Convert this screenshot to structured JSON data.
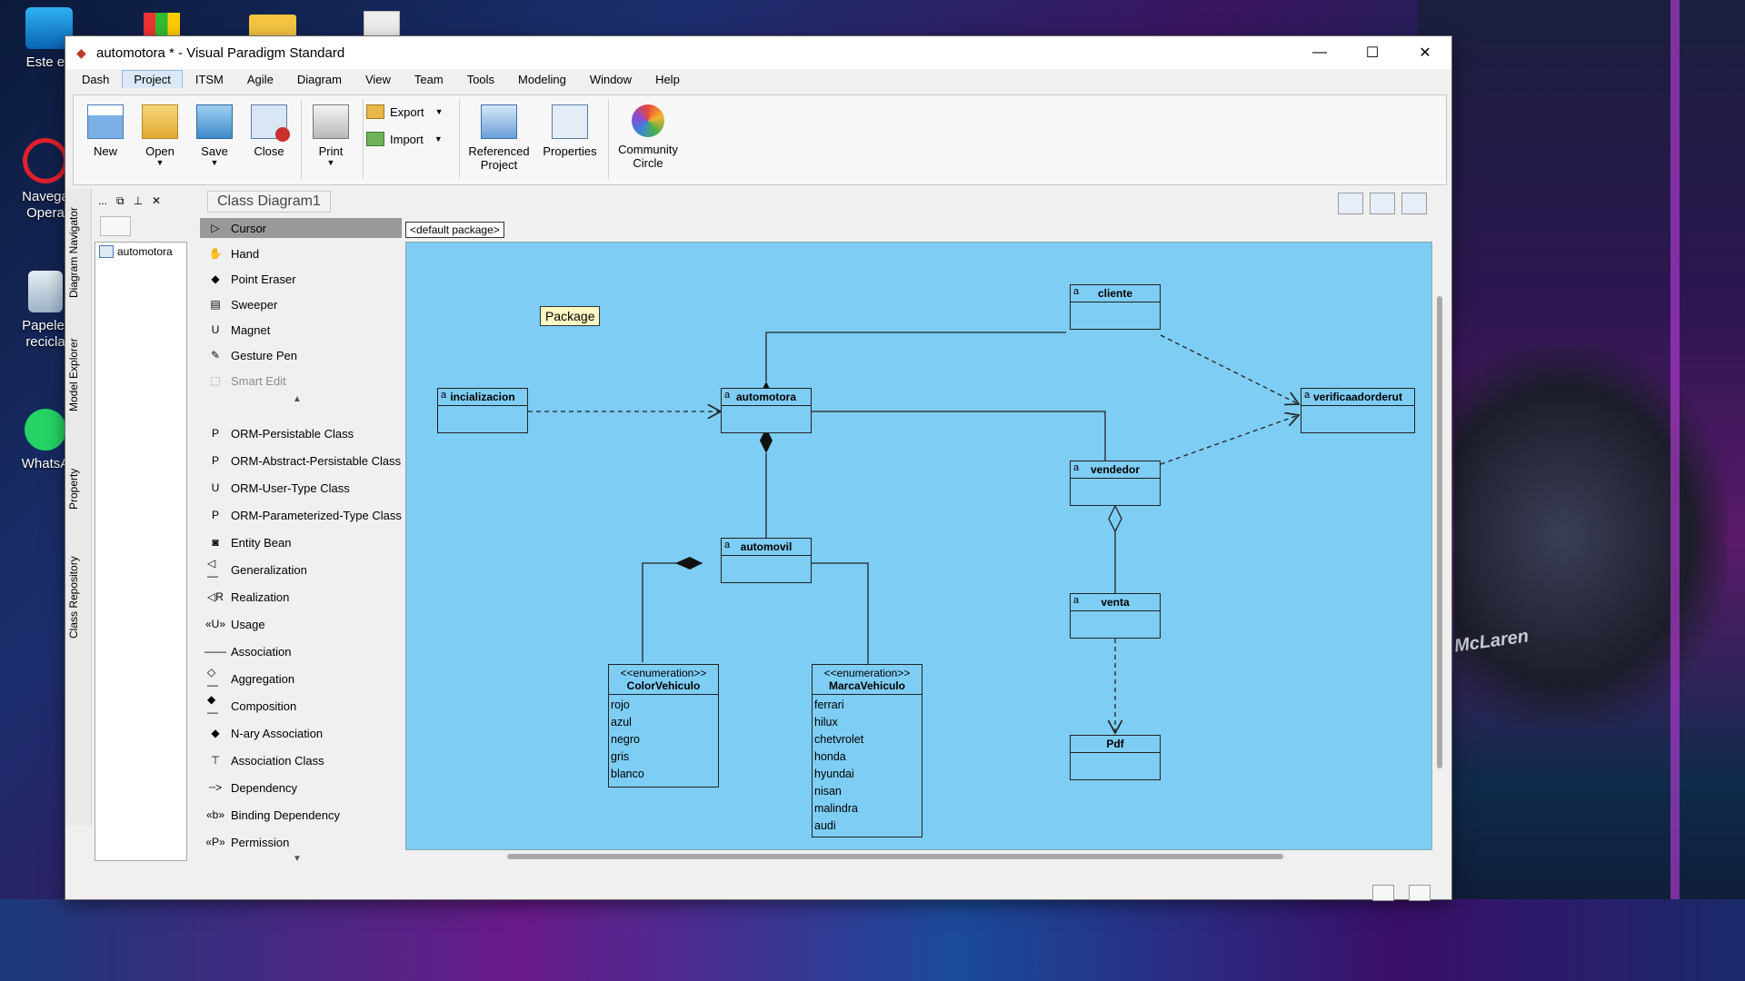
{
  "desktop": {
    "icons": [
      {
        "label": "Este eq"
      },
      {
        "label": "Navega Opera"
      },
      {
        "label": "Papeler recicla"
      },
      {
        "label": "WhatsA"
      }
    ],
    "car_text": "McLaren"
  },
  "window": {
    "title": "automotora * - Visual Paradigm Standard",
    "controls": {
      "minimize": "—",
      "maximize": "☐",
      "close": "✕"
    }
  },
  "menu": [
    "Dash",
    "Project",
    "ITSM",
    "Agile",
    "Diagram",
    "View",
    "Team",
    "Tools",
    "Modeling",
    "Window",
    "Help"
  ],
  "menu_active": "Project",
  "ribbon": {
    "new": "New",
    "open": "Open",
    "save": "Save",
    "close": "Close",
    "print": "Print",
    "export": "Export",
    "import": "Import",
    "referenced_project": [
      "Referenced",
      "Project"
    ],
    "properties": "Properties",
    "community_circle": [
      "Community",
      "Circle"
    ]
  },
  "side_tabs": [
    "Diagram Navigator",
    "Model Explorer",
    "Property",
    "Class Repository"
  ],
  "navigator": {
    "toolbar": [
      "...",
      "⧉",
      "⊥",
      "✕"
    ],
    "tree": [
      "automotora"
    ]
  },
  "breadcrumb": "Class Diagram1",
  "palette": {
    "items": [
      {
        "label": "Cursor",
        "icon": "cursor-icon",
        "glyph": "▷",
        "selected": true
      },
      {
        "label": "Hand",
        "icon": "hand-icon",
        "glyph": "✋"
      },
      {
        "label": "Point Eraser",
        "icon": "eraser-icon",
        "glyph": "◆"
      },
      {
        "label": "Sweeper",
        "icon": "sweeper-icon",
        "glyph": "▤"
      },
      {
        "label": "Magnet",
        "icon": "magnet-icon",
        "glyph": "U"
      },
      {
        "label": "Gesture Pen",
        "icon": "pen-icon",
        "glyph": "✎"
      },
      {
        "label": "Smart Edit",
        "icon": "smart-edit-icon",
        "glyph": "⬚",
        "disabled": true
      }
    ],
    "items2": [
      {
        "label": "ORM-Persistable Class",
        "icon": "orm-class-icon",
        "glyph": "P"
      },
      {
        "label": "ORM-Abstract-Persistable Class",
        "icon": "orm-abstract-icon",
        "glyph": "P"
      },
      {
        "label": "ORM-User-Type Class",
        "icon": "orm-usertype-icon",
        "glyph": "U"
      },
      {
        "label": "ORM-Parameterized-Type Class",
        "icon": "orm-param-icon",
        "glyph": "P"
      },
      {
        "label": "Entity Bean",
        "icon": "entity-bean-icon",
        "glyph": "◙"
      },
      {
        "label": "Generalization",
        "icon": "generalization-icon",
        "glyph": "◁—"
      },
      {
        "label": "Realization",
        "icon": "realization-icon",
        "glyph": "◁R"
      },
      {
        "label": "Usage",
        "icon": "usage-icon",
        "glyph": "«U»"
      },
      {
        "label": "Association",
        "icon": "association-icon",
        "glyph": "——"
      },
      {
        "label": "Aggregation",
        "icon": "aggregation-icon",
        "glyph": "◇—"
      },
      {
        "label": "Composition",
        "icon": "composition-icon",
        "glyph": "◆—"
      },
      {
        "label": "N-ary Association",
        "icon": "nary-icon",
        "glyph": "◆"
      },
      {
        "label": "Association Class",
        "icon": "assoc-class-icon",
        "glyph": "⊤"
      },
      {
        "label": "Dependency",
        "icon": "dependency-icon",
        "glyph": "┄>"
      },
      {
        "label": "Binding Dependency",
        "icon": "binding-icon",
        "glyph": "«b»"
      },
      {
        "label": "Permission",
        "icon": "permission-icon",
        "glyph": "«P»"
      }
    ]
  },
  "diagram": {
    "package_tab": "<default package>",
    "note": "Package",
    "classes": {
      "cliente": "cliente",
      "inicializacion": "incializacion",
      "automotora": "automotora",
      "verificador": "verificaadorderut",
      "vendedor": "vendedor",
      "automovil": "automovil",
      "venta": "venta",
      "pdf": "Pdf"
    },
    "class_marker": "a",
    "enum_color": {
      "stereotype": "<<enumeration>>",
      "name": "ColorVehiculo",
      "literals": [
        "rojo",
        "azul",
        "negro",
        "gris",
        "blanco"
      ]
    },
    "enum_marca": {
      "stereotype": "<<enumeration>>",
      "name": "MarcaVehiculo",
      "literals": [
        "ferrari",
        "hilux",
        "chetvrolet",
        "honda",
        "hyundai",
        "nisan",
        "malindra",
        "audi"
      ]
    }
  }
}
